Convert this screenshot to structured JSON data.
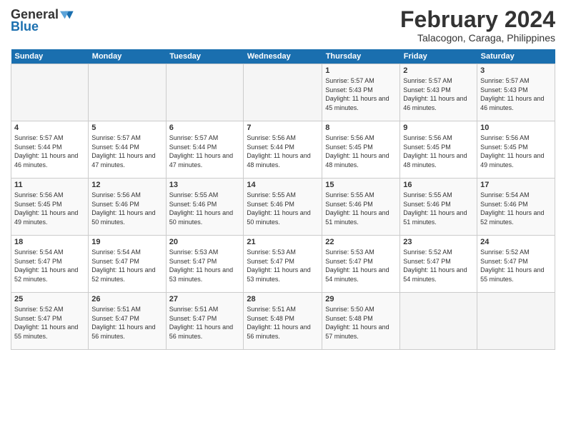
{
  "logo": {
    "general": "General",
    "blue": "Blue"
  },
  "title": "February 2024",
  "location": "Talacogon, Caraga, Philippines",
  "days_of_week": [
    "Sunday",
    "Monday",
    "Tuesday",
    "Wednesday",
    "Thursday",
    "Friday",
    "Saturday"
  ],
  "weeks": [
    [
      {
        "day": "",
        "info": ""
      },
      {
        "day": "",
        "info": ""
      },
      {
        "day": "",
        "info": ""
      },
      {
        "day": "",
        "info": ""
      },
      {
        "day": "1",
        "info": "Sunrise: 5:57 AM\nSunset: 5:43 PM\nDaylight: 11 hours and 45 minutes."
      },
      {
        "day": "2",
        "info": "Sunrise: 5:57 AM\nSunset: 5:43 PM\nDaylight: 11 hours and 46 minutes."
      },
      {
        "day": "3",
        "info": "Sunrise: 5:57 AM\nSunset: 5:43 PM\nDaylight: 11 hours and 46 minutes."
      }
    ],
    [
      {
        "day": "4",
        "info": "Sunrise: 5:57 AM\nSunset: 5:44 PM\nDaylight: 11 hours and 46 minutes."
      },
      {
        "day": "5",
        "info": "Sunrise: 5:57 AM\nSunset: 5:44 PM\nDaylight: 11 hours and 47 minutes."
      },
      {
        "day": "6",
        "info": "Sunrise: 5:57 AM\nSunset: 5:44 PM\nDaylight: 11 hours and 47 minutes."
      },
      {
        "day": "7",
        "info": "Sunrise: 5:56 AM\nSunset: 5:44 PM\nDaylight: 11 hours and 48 minutes."
      },
      {
        "day": "8",
        "info": "Sunrise: 5:56 AM\nSunset: 5:45 PM\nDaylight: 11 hours and 48 minutes."
      },
      {
        "day": "9",
        "info": "Sunrise: 5:56 AM\nSunset: 5:45 PM\nDaylight: 11 hours and 48 minutes."
      },
      {
        "day": "10",
        "info": "Sunrise: 5:56 AM\nSunset: 5:45 PM\nDaylight: 11 hours and 49 minutes."
      }
    ],
    [
      {
        "day": "11",
        "info": "Sunrise: 5:56 AM\nSunset: 5:45 PM\nDaylight: 11 hours and 49 minutes."
      },
      {
        "day": "12",
        "info": "Sunrise: 5:56 AM\nSunset: 5:46 PM\nDaylight: 11 hours and 50 minutes."
      },
      {
        "day": "13",
        "info": "Sunrise: 5:55 AM\nSunset: 5:46 PM\nDaylight: 11 hours and 50 minutes."
      },
      {
        "day": "14",
        "info": "Sunrise: 5:55 AM\nSunset: 5:46 PM\nDaylight: 11 hours and 50 minutes."
      },
      {
        "day": "15",
        "info": "Sunrise: 5:55 AM\nSunset: 5:46 PM\nDaylight: 11 hours and 51 minutes."
      },
      {
        "day": "16",
        "info": "Sunrise: 5:55 AM\nSunset: 5:46 PM\nDaylight: 11 hours and 51 minutes."
      },
      {
        "day": "17",
        "info": "Sunrise: 5:54 AM\nSunset: 5:46 PM\nDaylight: 11 hours and 52 minutes."
      }
    ],
    [
      {
        "day": "18",
        "info": "Sunrise: 5:54 AM\nSunset: 5:47 PM\nDaylight: 11 hours and 52 minutes."
      },
      {
        "day": "19",
        "info": "Sunrise: 5:54 AM\nSunset: 5:47 PM\nDaylight: 11 hours and 52 minutes."
      },
      {
        "day": "20",
        "info": "Sunrise: 5:53 AM\nSunset: 5:47 PM\nDaylight: 11 hours and 53 minutes."
      },
      {
        "day": "21",
        "info": "Sunrise: 5:53 AM\nSunset: 5:47 PM\nDaylight: 11 hours and 53 minutes."
      },
      {
        "day": "22",
        "info": "Sunrise: 5:53 AM\nSunset: 5:47 PM\nDaylight: 11 hours and 54 minutes."
      },
      {
        "day": "23",
        "info": "Sunrise: 5:52 AM\nSunset: 5:47 PM\nDaylight: 11 hours and 54 minutes."
      },
      {
        "day": "24",
        "info": "Sunrise: 5:52 AM\nSunset: 5:47 PM\nDaylight: 11 hours and 55 minutes."
      }
    ],
    [
      {
        "day": "25",
        "info": "Sunrise: 5:52 AM\nSunset: 5:47 PM\nDaylight: 11 hours and 55 minutes."
      },
      {
        "day": "26",
        "info": "Sunrise: 5:51 AM\nSunset: 5:47 PM\nDaylight: 11 hours and 56 minutes."
      },
      {
        "day": "27",
        "info": "Sunrise: 5:51 AM\nSunset: 5:47 PM\nDaylight: 11 hours and 56 minutes."
      },
      {
        "day": "28",
        "info": "Sunrise: 5:51 AM\nSunset: 5:48 PM\nDaylight: 11 hours and 56 minutes."
      },
      {
        "day": "29",
        "info": "Sunrise: 5:50 AM\nSunset: 5:48 PM\nDaylight: 11 hours and 57 minutes."
      },
      {
        "day": "",
        "info": ""
      },
      {
        "day": "",
        "info": ""
      }
    ]
  ]
}
